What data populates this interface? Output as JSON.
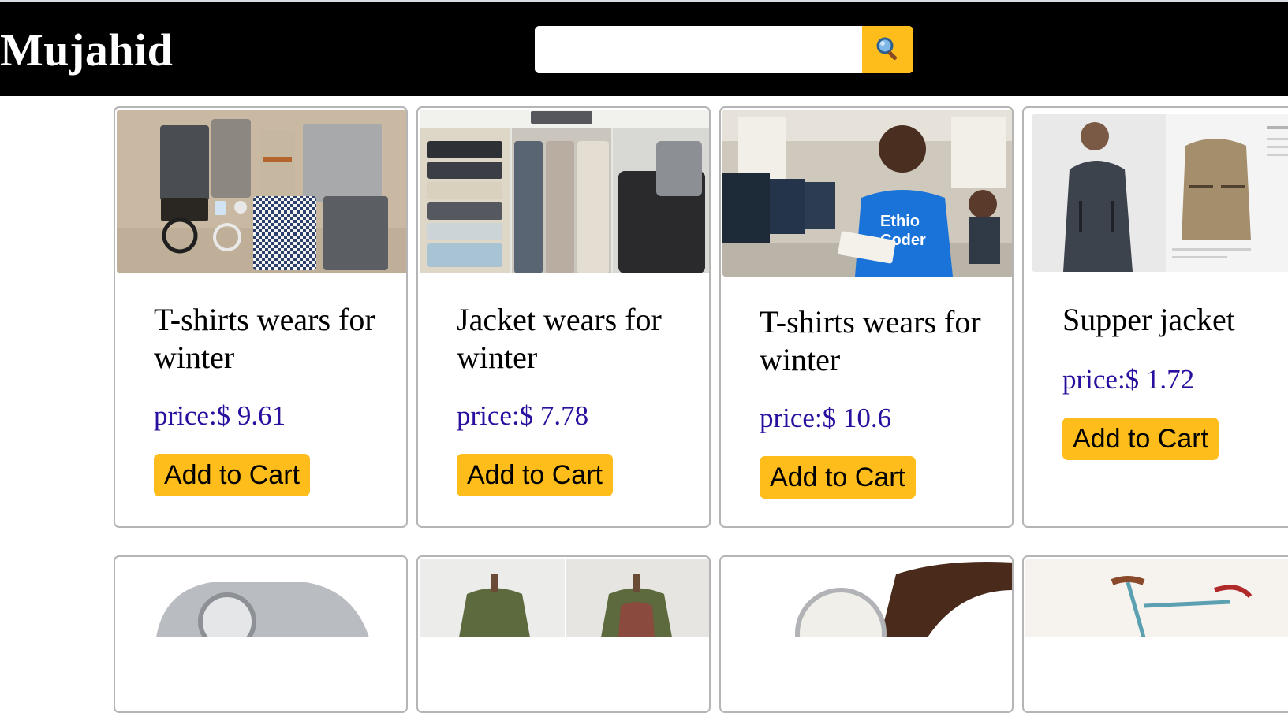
{
  "header": {
    "logo_text": "Mujahid",
    "search": {
      "value": "",
      "placeholder": ""
    },
    "search_icon": "magnifier-icon"
  },
  "colors": {
    "header_bg": "#000000",
    "accent": "#febd1b",
    "price": "#2a0f9e"
  },
  "products": [
    {
      "title": "T-shirts wears for winter",
      "price": "price:$ 9.61",
      "button": "Add to Cart",
      "image": "folded-clothes-flatlay"
    },
    {
      "title": "Jacket wears for winter",
      "price": "price:$ 7.78",
      "button": "Add to Cart",
      "image": "folded-sweaters-collage"
    },
    {
      "title": "T-shirts wears for winter",
      "price": "price:$ 10.6",
      "button": "Add to Cart",
      "image": "man-in-blue-tshirt-office"
    },
    {
      "title": "Supper jacket",
      "price": "price:$ 1.72",
      "button": "Add to Cart",
      "image": "jacket-product-sheet"
    }
  ],
  "row2_images": [
    "wristwatch",
    "jacket-on-mannequins",
    "watch-leather-strap",
    "bicycle"
  ]
}
